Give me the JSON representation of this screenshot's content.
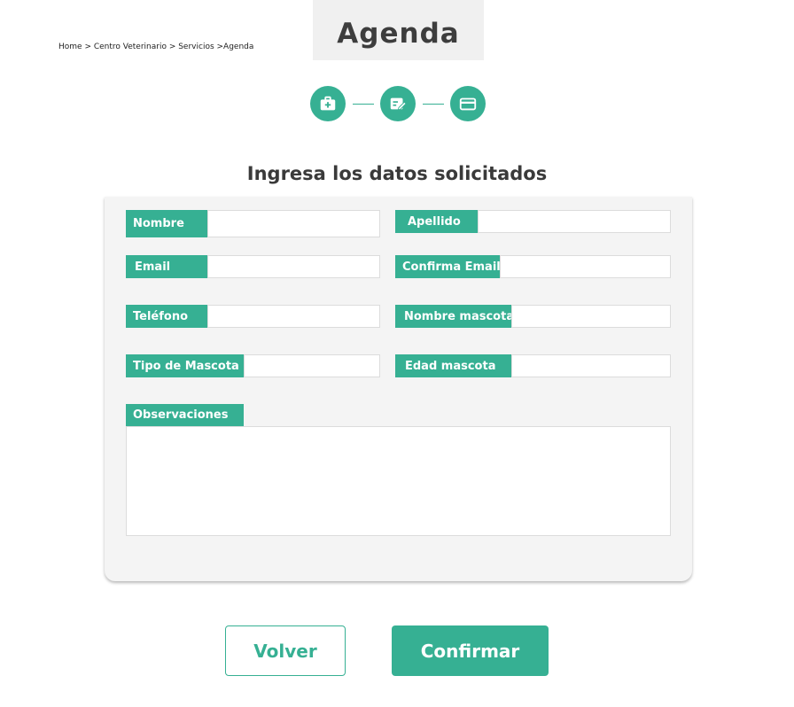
{
  "breadcrumb": "Home > Centro Veterinario > Servicios >Agenda",
  "page_title": "Agenda",
  "steps": [
    {
      "icon": "medical-kit-icon"
    },
    {
      "icon": "edit-form-icon"
    },
    {
      "icon": "credit-card-icon"
    }
  ],
  "form": {
    "heading": "Ingresa los datos solicitados",
    "fields": {
      "nombre": {
        "label": "Nombre",
        "value": ""
      },
      "apellido": {
        "label": "Apellido",
        "value": ""
      },
      "email": {
        "label": "Email",
        "value": ""
      },
      "confirma_email": {
        "label": "Confirma Email",
        "value": ""
      },
      "telefono": {
        "label": "Teléfono",
        "value": ""
      },
      "nombre_mascota": {
        "label": "Nombre mascota",
        "value": ""
      },
      "tipo_mascota": {
        "label": "Tipo de Mascota",
        "value": ""
      },
      "edad_mascota": {
        "label": "Edad mascota",
        "value": ""
      }
    },
    "observaciones": {
      "label": "Observaciones",
      "value": ""
    }
  },
  "buttons": {
    "back": "Volver",
    "confirm": "Confirmar"
  },
  "colors": {
    "accent": "#36b093",
    "card_bg": "#f4f4f4",
    "title_bg": "#f0f0f0"
  }
}
